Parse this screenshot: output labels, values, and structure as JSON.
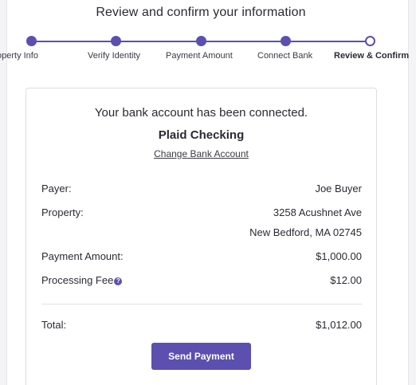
{
  "header": {
    "title": "Review and confirm your information"
  },
  "stepper": {
    "steps": [
      {
        "label": "Property Info",
        "state": "complete"
      },
      {
        "label": "Verify Identity",
        "state": "complete"
      },
      {
        "label": "Payment Amount",
        "state": "complete"
      },
      {
        "label": "Connect Bank",
        "state": "complete"
      },
      {
        "label": "Review & Confirm",
        "state": "current"
      }
    ]
  },
  "bank": {
    "connected_message": "Your bank account has been connected.",
    "account_name": "Plaid Checking",
    "change_link": "Change Bank Account"
  },
  "details": {
    "payer_label": "Payer:",
    "payer_value": "Joe Buyer",
    "property_label": "Property:",
    "property_line1": "3258 Acushnet Ave",
    "property_line2": "New Bedford, MA 02745",
    "amount_label": "Payment Amount:",
    "amount_value": "$1,000.00",
    "fee_label": "Processing Fee",
    "fee_value": "$12.00",
    "total_label": "Total:",
    "total_value": "$1,012.00"
  },
  "actions": {
    "send_label": "Send Payment"
  },
  "colors": {
    "accent": "#5b4fb0",
    "text": "#2a2b33",
    "border": "#dcdce2"
  },
  "icons": {
    "help": "question-circle-icon"
  }
}
